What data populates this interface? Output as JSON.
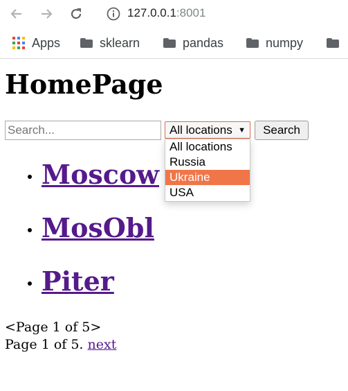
{
  "browser": {
    "url_host": "127.0.0.1",
    "url_port": ":8001",
    "bookmarks": [
      "Apps",
      "sklearn",
      "pandas",
      "numpy"
    ]
  },
  "page": {
    "title": "HomePage",
    "search_placeholder": "Search...",
    "search_value": "",
    "location_selected": "All locations",
    "location_options": [
      "All locations",
      "Russia",
      "Ukraine",
      "USA"
    ],
    "highlighted_option": "Ukraine",
    "search_button": "Search",
    "cities": [
      "Moscow",
      "MosObl",
      "Piter"
    ],
    "pager_line1": "<Page 1 of 5>",
    "pager_line2": "Page 1 of 5.",
    "next_link": "next"
  },
  "colors": {
    "link_visited": "#551a8b",
    "select_focus": "#e06a43",
    "option_highlight": "#f0764a"
  }
}
